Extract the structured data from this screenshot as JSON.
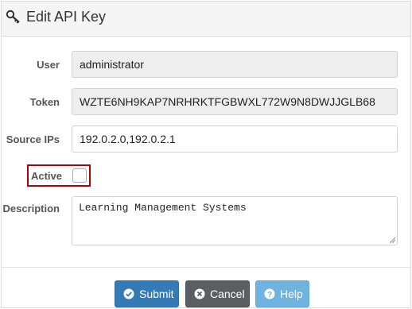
{
  "header": {
    "title": "Edit API Key",
    "icon": "key-icon"
  },
  "form": {
    "user": {
      "label": "User",
      "value": "administrator"
    },
    "token": {
      "label": "Token",
      "value": "WZTE6NH9KAP7NRHRKTFGBWXL772W9N8DWJJGLB68"
    },
    "source_ips": {
      "label": "Source IPs",
      "value": "192.0.2.0,192.0.2.1"
    },
    "active": {
      "label": "Active",
      "checked": false
    },
    "description": {
      "label": "Description",
      "value": "Learning Management Systems"
    }
  },
  "buttons": {
    "submit": {
      "label": "Submit",
      "icon": "check-circle-icon",
      "color": "#337ab7"
    },
    "cancel": {
      "label": "Cancel",
      "icon": "close-circle-icon",
      "color": "#5b5f63"
    },
    "help": {
      "label": "Help",
      "icon": "question-circle-icon",
      "color": "#6fb3e0"
    }
  },
  "colors": {
    "highlight_border": "#b30000",
    "readonly_field": "#eeeeee",
    "header_bg": "#f5f5f5"
  }
}
